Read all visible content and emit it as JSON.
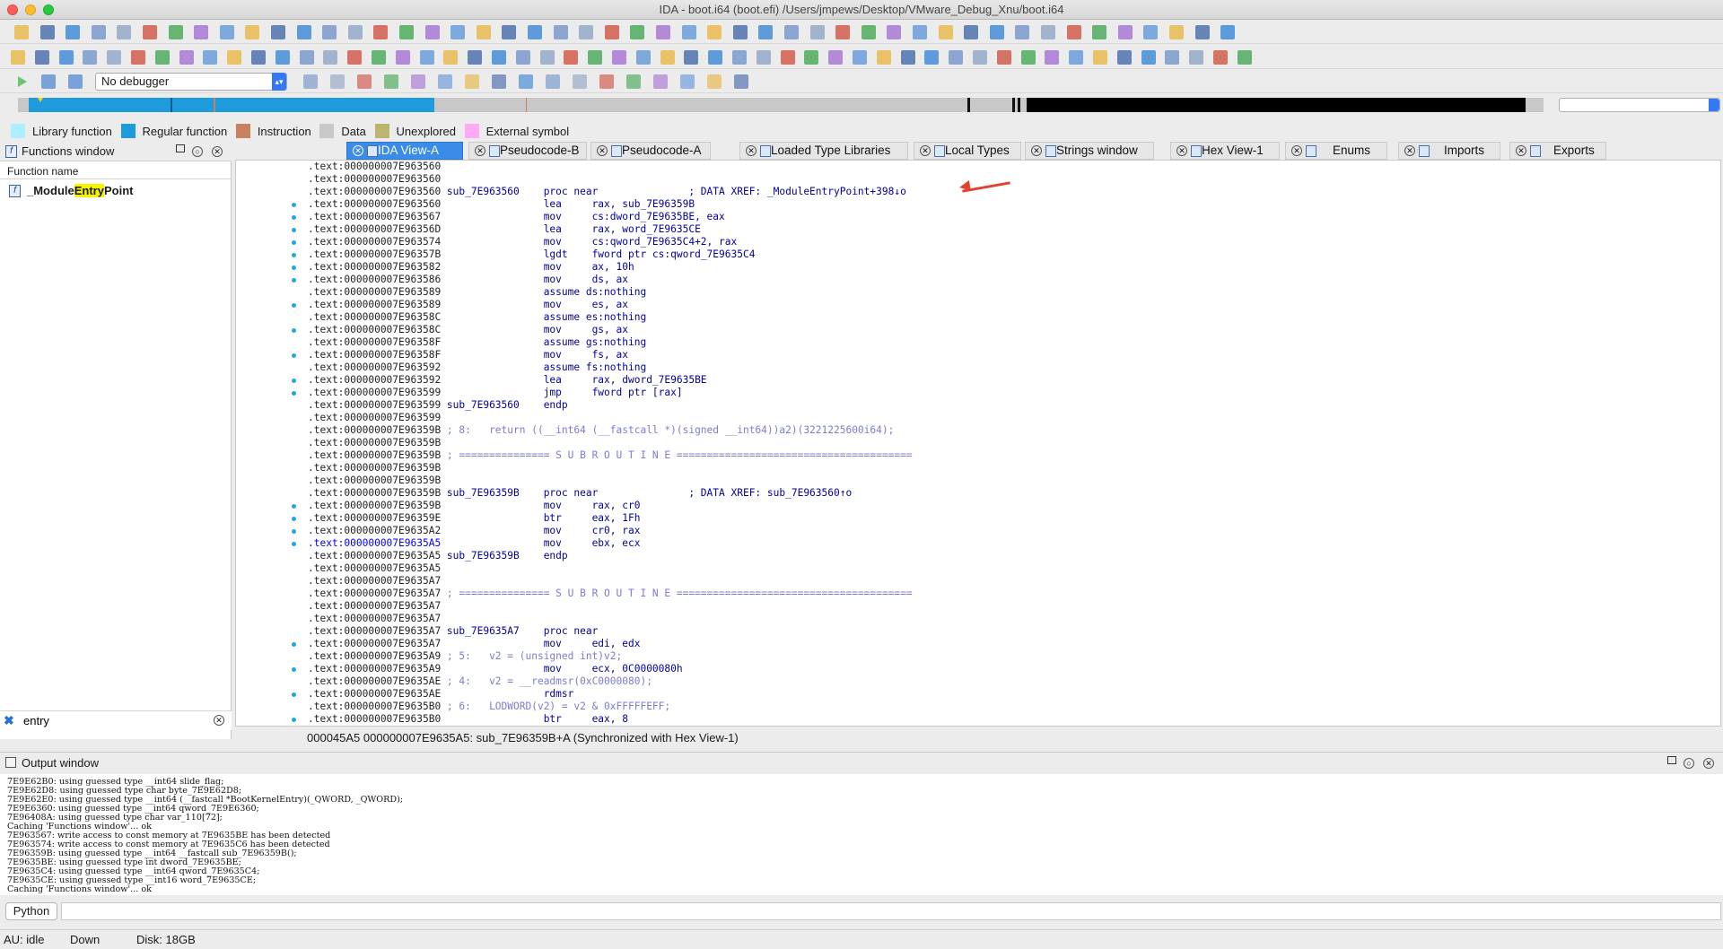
{
  "window": {
    "title": "IDA - boot.i64 (boot.efi) /Users/jmpews/Desktop/VMware_Debug_Xnu/boot.i64"
  },
  "toolbar": {
    "debugger_select": "No debugger"
  },
  "legend": [
    {
      "label": "Library function",
      "color": "#aeeeff"
    },
    {
      "label": "Regular function",
      "color": "#1e9bdc"
    },
    {
      "label": "Instruction",
      "color": "#c98261"
    },
    {
      "label": "Data",
      "color": "#c8c8c8"
    },
    {
      "label": "Unexplored",
      "color": "#bdb56e"
    },
    {
      "label": "External symbol",
      "color": "#ffaaf5"
    }
  ],
  "functions_window": {
    "title": "Functions window",
    "column_header": "Function name",
    "items": [
      {
        "prefix": "_Module",
        "match": "Entry",
        "suffix": "Point"
      }
    ],
    "filter_value": "entry"
  },
  "tabs": [
    {
      "label": "IDA View-A",
      "active": true
    },
    {
      "label": "Pseudocode-B",
      "active": false
    },
    {
      "label": "Pseudocode-A",
      "active": false
    },
    {
      "label": "Loaded Type Libraries",
      "active": false
    },
    {
      "label": "Local Types",
      "active": false
    },
    {
      "label": "Strings window",
      "active": false
    },
    {
      "label": "Hex View-1",
      "active": false
    },
    {
      "label": "Enums",
      "active": false
    },
    {
      "label": "Imports",
      "active": false
    },
    {
      "label": "Exports",
      "active": false
    }
  ],
  "disassembly": {
    "lines": [
      {
        "addr": ".text:000000007E963560",
        "text": ""
      },
      {
        "addr": ".text:000000007E963560",
        "text": ""
      },
      {
        "addr": ".text:000000007E963560",
        "text": " sub_7E963560    proc near               ; DATA XREF: _ModuleEntryPoint+398↓o"
      },
      {
        "addr": ".text:000000007E963560",
        "text": "                 lea     rax, sub_7E96359B"
      },
      {
        "addr": ".text:000000007E963567",
        "text": "                 mov     cs:dword_7E9635BE, eax"
      },
      {
        "addr": ".text:000000007E96356D",
        "text": "                 lea     rax, word_7E9635CE"
      },
      {
        "addr": ".text:000000007E963574",
        "text": "                 mov     cs:qword_7E9635C4+2, rax"
      },
      {
        "addr": ".text:000000007E96357B",
        "text": "                 lgdt    fword ptr cs:qword_7E9635C4"
      },
      {
        "addr": ".text:000000007E963582",
        "text": "                 mov     ax, 10h"
      },
      {
        "addr": ".text:000000007E963586",
        "text": "                 mov     ds, ax"
      },
      {
        "addr": ".text:000000007E963589",
        "text": "                 assume ds:nothing"
      },
      {
        "addr": ".text:000000007E963589",
        "text": "                 mov     es, ax"
      },
      {
        "addr": ".text:000000007E96358C",
        "text": "                 assume es:nothing"
      },
      {
        "addr": ".text:000000007E96358C",
        "text": "                 mov     gs, ax"
      },
      {
        "addr": ".text:000000007E96358F",
        "text": "                 assume gs:nothing"
      },
      {
        "addr": ".text:000000007E96358F",
        "text": "                 mov     fs, ax"
      },
      {
        "addr": ".text:000000007E963592",
        "text": "                 assume fs:nothing"
      },
      {
        "addr": ".text:000000007E963592",
        "text": "                 lea     rax, dword_7E9635BE"
      },
      {
        "addr": ".text:000000007E963599",
        "text": "                 jmp     fword ptr [rax]"
      },
      {
        "addr": ".text:000000007E963599",
        "text": " sub_7E963560    endp"
      },
      {
        "addr": ".text:000000007E963599",
        "text": ""
      },
      {
        "addr": ".text:000000007E96359B",
        "text": " ; 8:   return ((__int64 (__fastcall *)(signed __int64))a2)(3221225600i64);"
      },
      {
        "addr": ".text:000000007E96359B",
        "text": ""
      },
      {
        "addr": ".text:000000007E96359B",
        "text": " ; =============== S U B R O U T I N E ======================================="
      },
      {
        "addr": ".text:000000007E96359B",
        "text": ""
      },
      {
        "addr": ".text:000000007E96359B",
        "text": ""
      },
      {
        "addr": ".text:000000007E96359B",
        "text": " sub_7E96359B    proc near               ; DATA XREF: sub_7E963560↑o"
      },
      {
        "addr": ".text:000000007E96359B",
        "text": "                 mov     rax, cr0"
      },
      {
        "addr": ".text:000000007E96359E",
        "text": "                 btr     eax, 1Fh"
      },
      {
        "addr": ".text:000000007E9635A2",
        "text": "                 mov     cr0, rax"
      },
      {
        "addr": ".text:000000007E9635A5",
        "text": "                 mov     ebx, ecx",
        "selected": true
      },
      {
        "addr": ".text:000000007E9635A5",
        "text": " sub_7E96359B    endp"
      },
      {
        "addr": ".text:000000007E9635A5",
        "text": ""
      },
      {
        "addr": ".text:000000007E9635A7",
        "text": ""
      },
      {
        "addr": ".text:000000007E9635A7",
        "text": " ; =============== S U B R O U T I N E ======================================="
      },
      {
        "addr": ".text:000000007E9635A7",
        "text": ""
      },
      {
        "addr": ".text:000000007E9635A7",
        "text": ""
      },
      {
        "addr": ".text:000000007E9635A7",
        "text": " sub_7E9635A7    proc near"
      },
      {
        "addr": ".text:000000007E9635A7",
        "text": "                 mov     edi, edx"
      },
      {
        "addr": ".text:000000007E9635A9",
        "text": " ; 5:   v2 = (unsigned int)v2;"
      },
      {
        "addr": ".text:000000007E9635A9",
        "text": "                 mov     ecx, 0C0000080h"
      },
      {
        "addr": ".text:000000007E9635AE",
        "text": " ; 4:   v2 = __readmsr(0xC0000080);"
      },
      {
        "addr": ".text:000000007E9635AE",
        "text": "                 rdmsr"
      },
      {
        "addr": ".text:000000007E9635B0",
        "text": " ; 6:   LODWORD(v2) = v2 & 0xFFFFFEFF;"
      },
      {
        "addr": ".text:000000007E9635B0",
        "text": "                 btr     eax, 8"
      }
    ]
  },
  "disasm_status": "000045A5  000000007E9635A5: sub_7E96359B+A  (Synchronized with Hex View-1)",
  "output_window": {
    "title": "Output window",
    "lines": [
      "7E9E62B0: using guessed type __int64 slide_flag;",
      "7E9E62D8: using guessed type char byte_7E9E62D8;",
      "7E9E62E0: using guessed type __int64 (__fastcall *BootKernelEntry)(_QWORD, _QWORD);",
      "7E9E6360: using guessed type __int64 qword_7E9E6360;",
      "7E96408A: using guessed type char var_110[72];",
      "Caching 'Functions window'... ok",
      "7E963567: write access to const memory at 7E9635BE has been detected",
      "7E963574: write access to const memory at 7E9635C6 has been detected",
      "7E96359B: using guessed type __int64 __fastcall sub_7E96359B();",
      "7E9635BE: using guessed type int dword_7E9635BE;",
      "7E9635C4: using guessed type __int64 qword_7E9635C4;",
      "7E9635CE: using guessed type __int16 word_7E9635CE;",
      "Caching 'Functions window'... ok"
    ]
  },
  "python_button": "Python",
  "statusbar": {
    "au": "AU:  idle",
    "direction": "Down",
    "disk": "Disk: 18GB"
  }
}
